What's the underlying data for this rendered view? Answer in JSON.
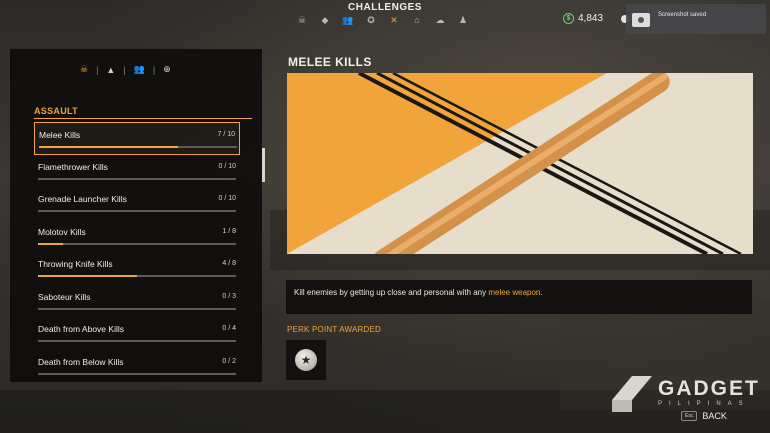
{
  "header": {
    "title": "CHALLENGES",
    "tab_icons": [
      "skull-icon",
      "diamond-icon",
      "group-icon",
      "badge-icon",
      "zombie-icon",
      "vehicle-icon",
      "cloud-icon",
      "person-icon"
    ],
    "active_tab_index": 4,
    "cash": "4,843",
    "cash_symbol": "$"
  },
  "toast": {
    "text": "Screenshot saved"
  },
  "filters": {
    "icons": [
      "skull-icon",
      "mountain-icon",
      "group-icon",
      "crosshair-icon"
    ],
    "separator": "|"
  },
  "category": "ASSAULT",
  "challenges": [
    {
      "name": "Melee Kills",
      "count": "7 / 10",
      "progress": 0.7
    },
    {
      "name": "Flamethrower Kills",
      "count": "0 / 10",
      "progress": 0.0
    },
    {
      "name": "Grenade Launcher Kills",
      "count": "0 / 10",
      "progress": 0.0
    },
    {
      "name": "Molotov Kills",
      "count": "1 / 8",
      "progress": 0.125
    },
    {
      "name": "Throwing Knife Kills",
      "count": "4 / 8",
      "progress": 0.5
    },
    {
      "name": "Saboteur Kills",
      "count": "0 / 3",
      "progress": 0.0
    },
    {
      "name": "Death from Above Kills",
      "count": "0 / 4",
      "progress": 0.0
    },
    {
      "name": "Death from Below Kills",
      "count": "0 / 2",
      "progress": 0.0
    }
  ],
  "detail": {
    "title": "MELEE KILLS",
    "description_prefix": "Kill enemies by getting up close and personal with any ",
    "description_highlight": "melee weapon",
    "description_suffix": ".",
    "perk_label": "PERK POINT AWARDED"
  },
  "colors": {
    "accent": "#f0a43a",
    "panel": "#0e0d0c"
  },
  "watermark": {
    "big": "GADGET",
    "small": "PILIPINAS"
  },
  "back": {
    "key": "Esc",
    "label": "BACK"
  }
}
